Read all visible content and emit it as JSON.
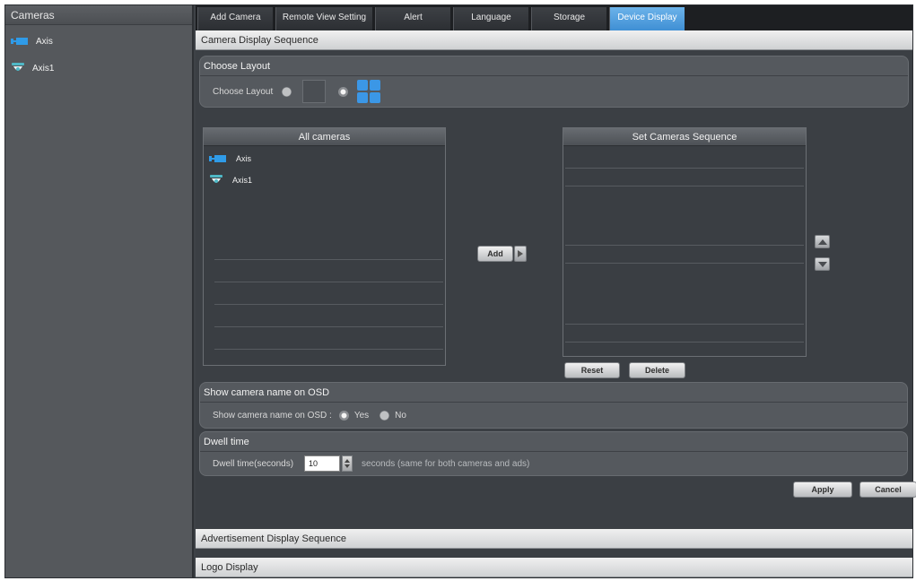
{
  "sidebar": {
    "title": "Cameras",
    "items": [
      {
        "label": "Axis",
        "icon": "box-camera-icon"
      },
      {
        "label": "Axis1",
        "icon": "dome-camera-icon"
      }
    ]
  },
  "tabs": [
    {
      "label": "Add Camera",
      "active": false
    },
    {
      "label": "Remote View Setting",
      "active": false
    },
    {
      "label": "Alert",
      "active": false
    },
    {
      "label": "Language",
      "active": false
    },
    {
      "label": "Storage",
      "active": false
    },
    {
      "label": "Device Display",
      "active": true
    }
  ],
  "main": {
    "section_title": "Camera Display Sequence",
    "layout_group": {
      "title": "Choose Layout",
      "label": "Choose Layout",
      "selected": "quad"
    },
    "all_cameras": {
      "title": "All cameras",
      "items": [
        {
          "label": "Axis",
          "icon": "box-camera-icon"
        },
        {
          "label": "Axis1",
          "icon": "dome-camera-icon"
        }
      ]
    },
    "add_button": "Add",
    "sequence": {
      "title": "Set Cameras Sequence",
      "reset_button": "Reset",
      "delete_button": "Delete"
    },
    "osd_group": {
      "title": "Show camera name on OSD",
      "label": "Show camera name on OSD :",
      "yes": "Yes",
      "no": "No",
      "selected": "yes"
    },
    "dwell_group": {
      "title": "Dwell time",
      "label": "Dwell time(seconds)",
      "value": "10",
      "note": "seconds (same for both cameras and ads)"
    },
    "apply_button": "Apply",
    "cancel_button": "Cancel",
    "ad_section_title": "Advertisement Display Sequence",
    "logo_section_title": "Logo Display"
  },
  "colors": {
    "accent": "#3f8fd4",
    "panel_bg": "#3b3f44",
    "sidebar_bg": "#55585c"
  }
}
